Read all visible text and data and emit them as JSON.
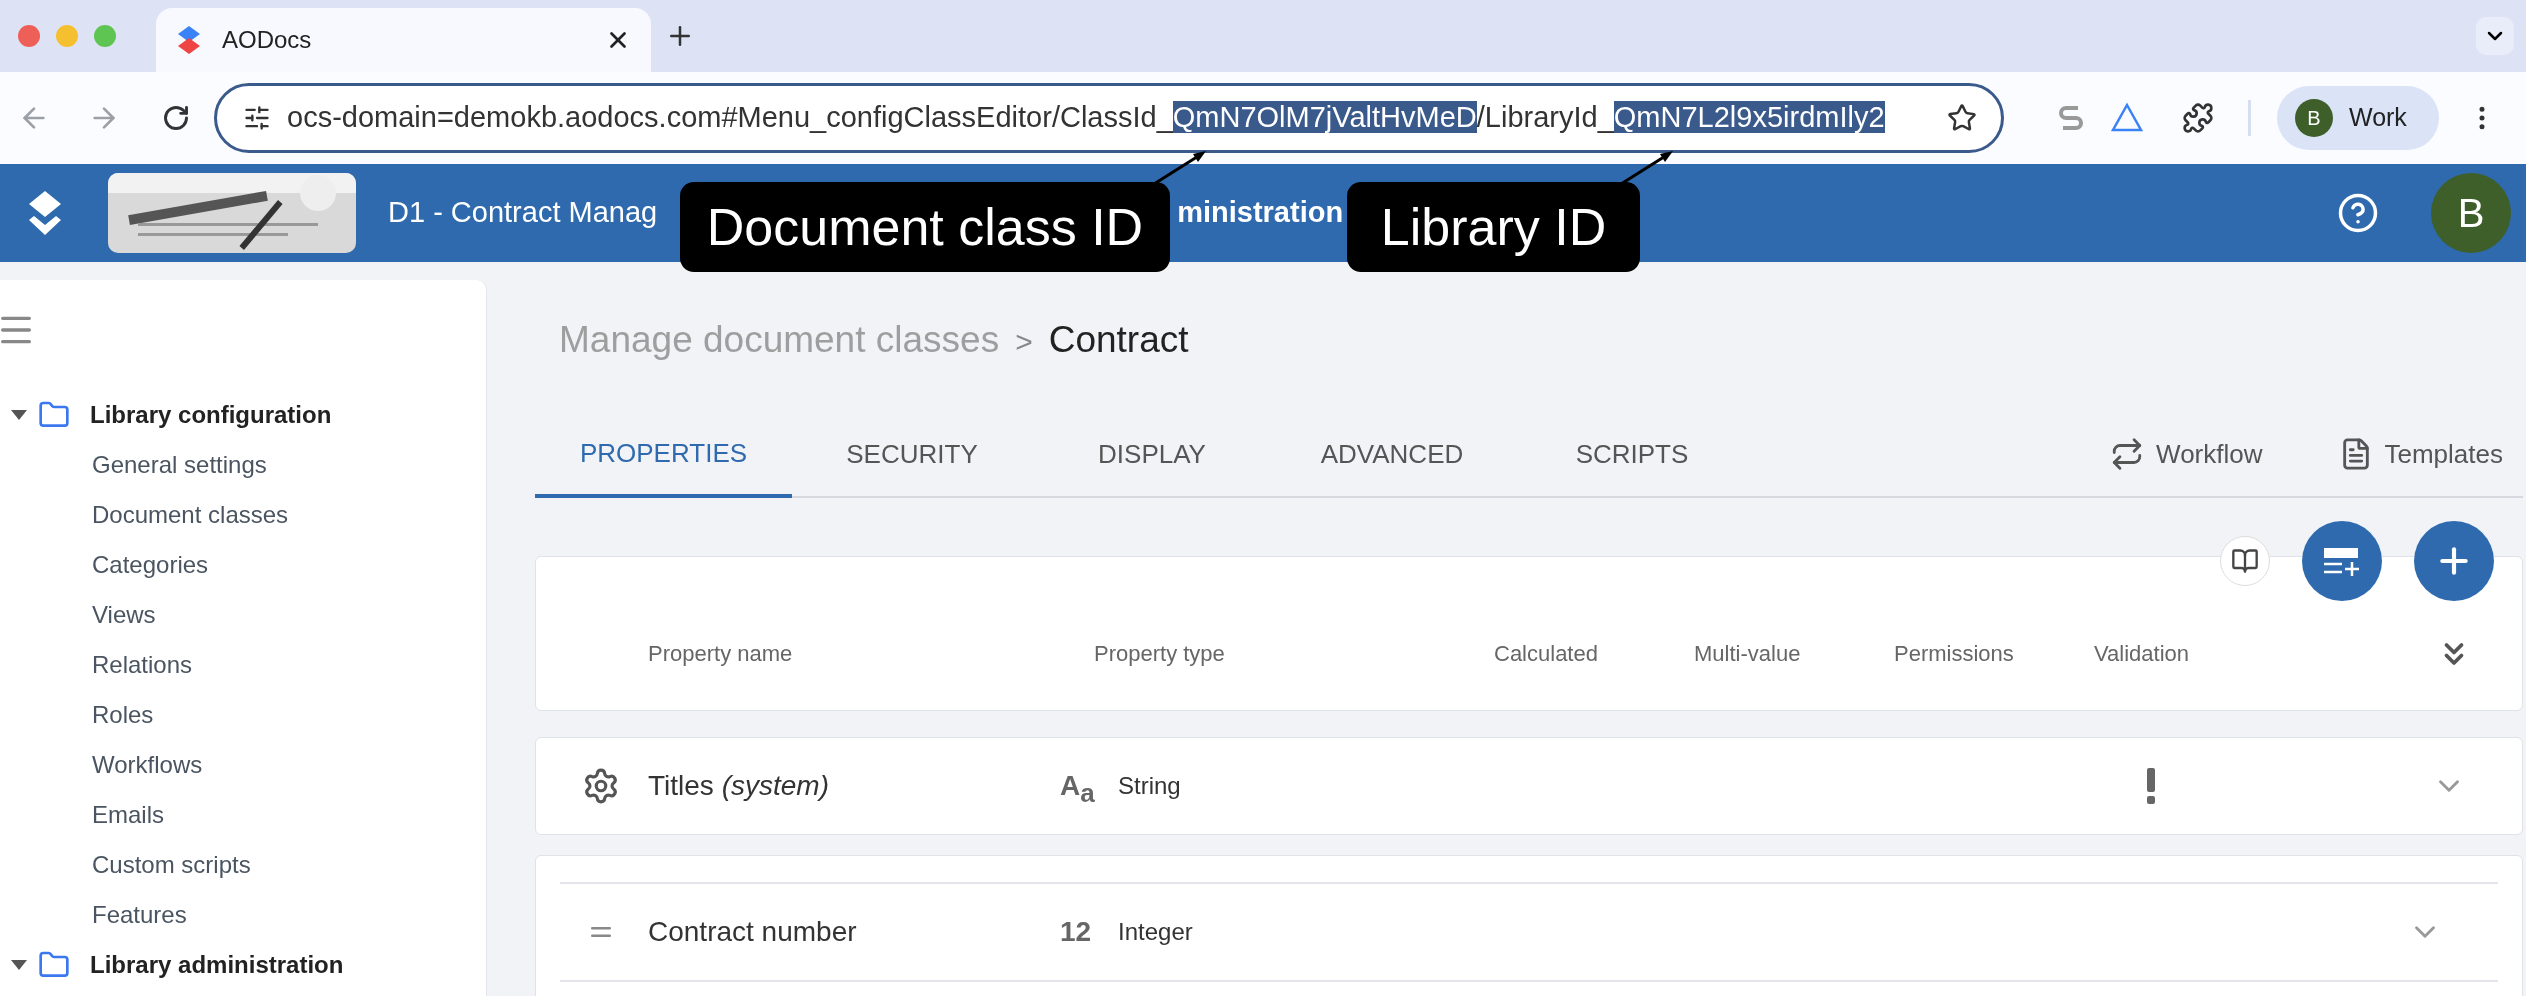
{
  "browser": {
    "tab_title": "AODocs",
    "url": {
      "prefix": "ocs-domain=demokb.aodocs.com#Menu_configClassEditor/ClassId_",
      "class_id": "QmN7OlM7jValtHvMeD",
      "middle": "/LibraryId_",
      "library_id": "QmN7L2l9x5irdmIly2"
    },
    "profile": {
      "initial": "B",
      "label": "Work"
    }
  },
  "app_header": {
    "title_start": "D1 - Contract Manag",
    "title_end": "ministration",
    "avatar": "B"
  },
  "callouts": [
    {
      "label": "Document class ID"
    },
    {
      "label": "Library ID"
    }
  ],
  "sidebar": {
    "groups": [
      {
        "label": "Library configuration",
        "expanded": true,
        "children": [
          {
            "label": "General settings"
          },
          {
            "label": "Document classes"
          },
          {
            "label": "Categories"
          },
          {
            "label": "Views"
          },
          {
            "label": "Relations"
          },
          {
            "label": "Roles"
          },
          {
            "label": "Workflows"
          },
          {
            "label": "Emails"
          },
          {
            "label": "Custom scripts"
          },
          {
            "label": "Features"
          }
        ]
      },
      {
        "label": "Library administration",
        "expanded": true
      }
    ]
  },
  "breadcrumb": {
    "parent": "Manage document classes",
    "separator": ">",
    "current": "Contract"
  },
  "tabs": [
    {
      "label": "PROPERTIES",
      "selected": true
    },
    {
      "label": "SECURITY",
      "selected": false
    },
    {
      "label": "DISPLAY",
      "selected": false
    },
    {
      "label": "ADVANCED",
      "selected": false
    },
    {
      "label": "SCRIPTS",
      "selected": false
    }
  ],
  "side_actions": [
    {
      "kind": "workflow",
      "label": "Workflow"
    },
    {
      "kind": "templates",
      "label": "Templates"
    }
  ],
  "table": {
    "columns": [
      "Property name",
      "Property type",
      "Calculated",
      "Multi-value",
      "Permissions",
      "Validation"
    ],
    "rows": [
      {
        "kind": "system",
        "name": "Titles *(system)*",
        "type_icon": "A$_{a}$",
        "type": "String",
        "validation": true
      },
      {
        "kind": "regular",
        "name": "Contract number",
        "type_icon": "12",
        "type": "Integer",
        "validation": false
      }
    ]
  }
}
